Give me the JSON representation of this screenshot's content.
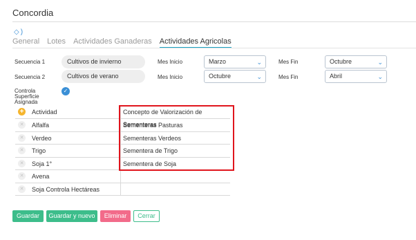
{
  "app": {
    "title": "Concordia"
  },
  "tabs": [
    {
      "label": "General",
      "active": false
    },
    {
      "label": "Lotes",
      "active": false
    },
    {
      "label": "Actividades Ganaderas",
      "active": false
    },
    {
      "label": "Actividades Agricolas",
      "active": true
    }
  ],
  "form": {
    "secuencia1": {
      "label": "Secuencia 1",
      "value": "Cultivos de invierno",
      "mes_inicio_label": "Mes Inicio",
      "mes_inicio": "Marzo",
      "mes_fin_label": "Mes Fin",
      "mes_fin": "Octubre"
    },
    "secuencia2": {
      "label": "Secuencia 2",
      "value": "Cultivos de verano",
      "mes_inicio_label": "Mes Inicio",
      "mes_inicio": "Octubre",
      "mes_fin_label": "Mes Fin",
      "mes_fin": "Abril"
    },
    "controla": {
      "label_1": "Controla",
      "label_2": "Superficie",
      "label_3": "Asignada",
      "checked": true
    }
  },
  "table": {
    "headers": {
      "actividad": "Actividad",
      "concepto": "Concepto de Valorización de Sementeras"
    },
    "rows": [
      {
        "actividad": "Alfalfa",
        "concepto": "Sementeras Pasturas"
      },
      {
        "actividad": "Verdeo",
        "concepto": "Sementeras Verdeos"
      },
      {
        "actividad": "Trigo",
        "concepto": "Sementera de Trigo"
      },
      {
        "actividad": "Soja 1°",
        "concepto": "Sementera de Soja"
      },
      {
        "actividad": "Avena",
        "concepto": ""
      },
      {
        "actividad": "Soja Controla Hectáreas",
        "concepto": ""
      }
    ]
  },
  "buttons": {
    "guardar": "Guardar",
    "guardar_nuevo": "Guardar y nuevo",
    "eliminar": "Eliminar",
    "cerrar": "Cerrar"
  },
  "colors": {
    "accent": "#1aa3c3",
    "primary": "#3dbd8b",
    "danger": "#f26b8a",
    "highlight": "#e0141c"
  }
}
